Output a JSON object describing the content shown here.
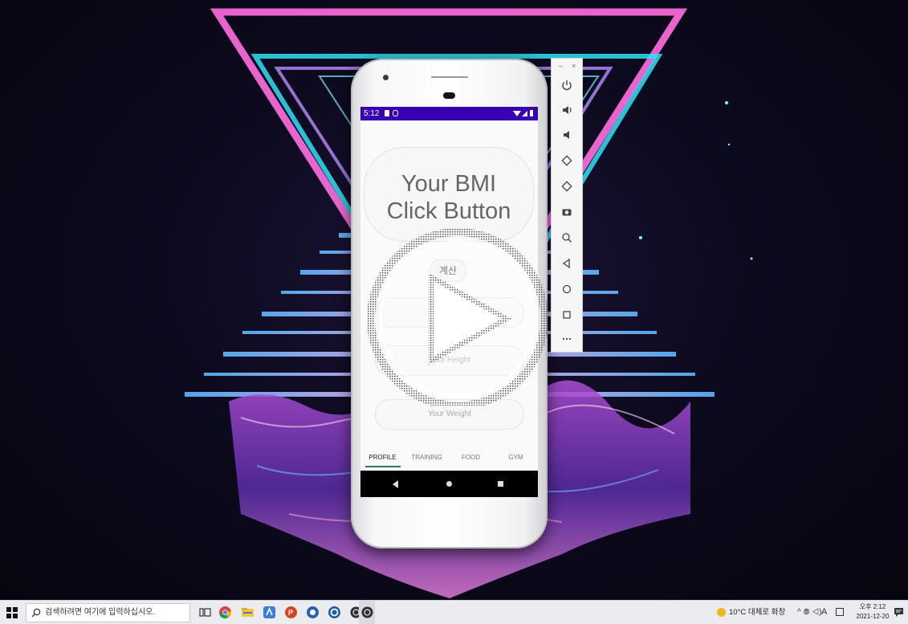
{
  "colors": {
    "status_bar": "#3700b3",
    "neon_pink": "#ff4fd8",
    "neon_cyan": "#34d8f0",
    "neon_violet": "#8a6cff",
    "tab_indicator": "#2a7a5a"
  },
  "phone": {
    "status_time": "5:12",
    "bmi_line1": "Your BMI",
    "bmi_line2": "Click Button",
    "calc_label": "계산",
    "field_1": "",
    "field_2": "Your Height",
    "field_3": "Your Weight",
    "tabs": [
      {
        "label": "PROFILE",
        "selected": true
      },
      {
        "label": "TRAINING",
        "selected": false
      },
      {
        "label": "FOOD",
        "selected": false
      },
      {
        "label": "GYM",
        "selected": false
      }
    ]
  },
  "emulator_toolbar": {
    "minimize": "–",
    "close": "×",
    "buttons": [
      "power-icon",
      "volume-up-icon",
      "volume-down-icon",
      "rotate-left-icon",
      "rotate-right-icon",
      "camera-icon",
      "zoom-icon",
      "back-icon",
      "home-icon",
      "overview-icon",
      "more-icon"
    ]
  },
  "taskbar": {
    "search_placeholder": "검색하려면 여기에 입력하십시오.",
    "apps": [
      "task-view-icon",
      "chrome-icon",
      "file-explorer-icon",
      "android-studio-icon",
      "powerpoint-icon",
      "app-icon",
      "app-icon",
      "app-icon"
    ],
    "weather": "10°C 대체로 화창",
    "tray_icons": "^ ⦾ ◁)",
    "lang": "A",
    "time": "오후 2:12",
    "date": "2021-12-20"
  }
}
